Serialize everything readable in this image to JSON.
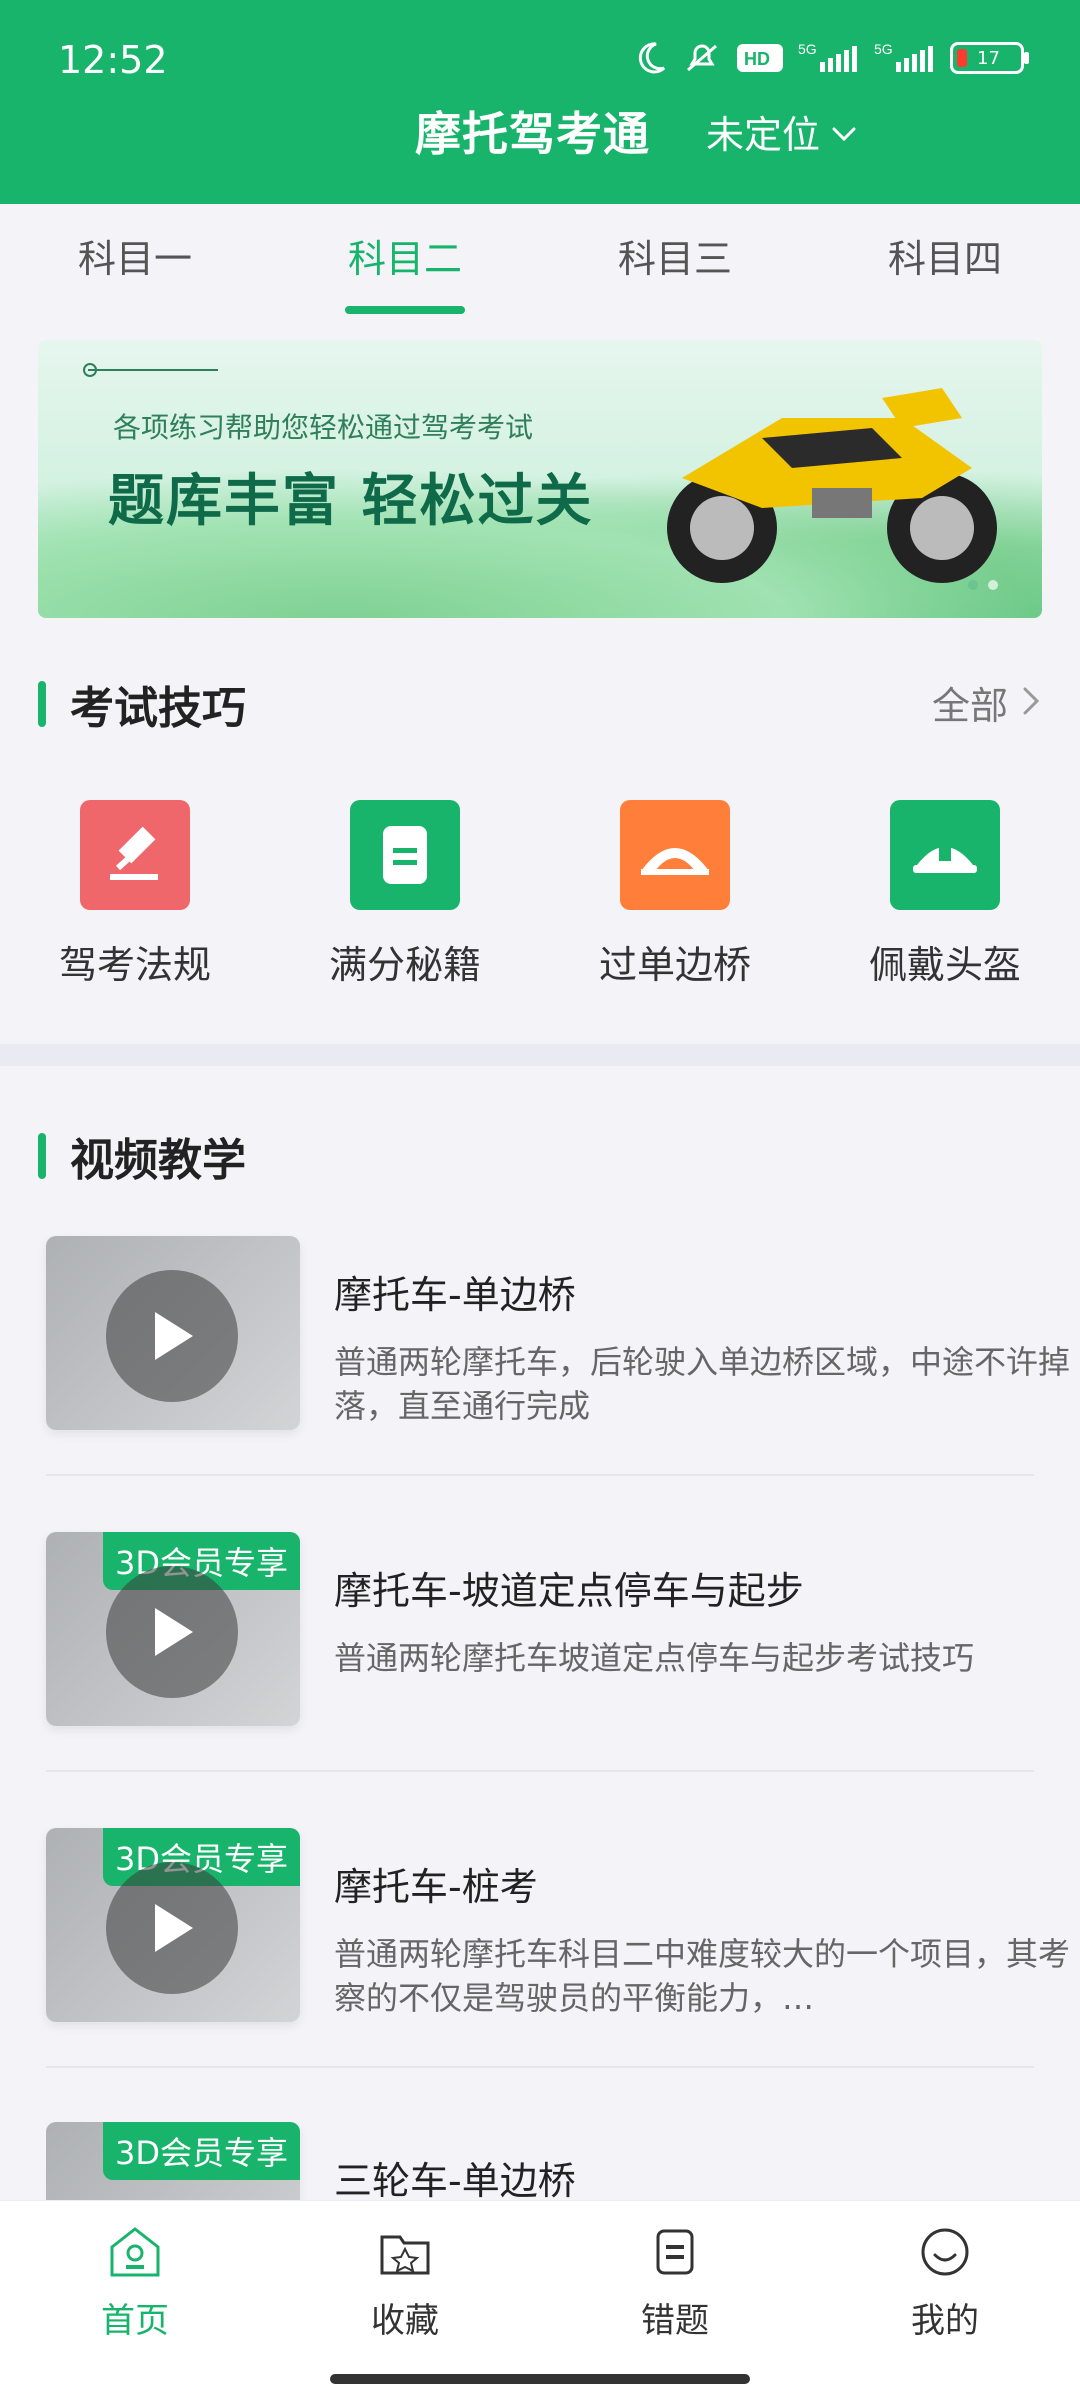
{
  "status_bar": {
    "time": "12:52",
    "battery": "17",
    "icons": [
      "moon-icon",
      "mute-icon",
      "hd-icon",
      "signal-5g-icon",
      "signal-5g-icon-2",
      "battery-icon"
    ]
  },
  "header": {
    "title": "摩托驾考通",
    "location": "未定位"
  },
  "tabs": [
    {
      "label": "科目一",
      "active": false
    },
    {
      "label": "科目二",
      "active": true
    },
    {
      "label": "科目三",
      "active": false
    },
    {
      "label": "科目四",
      "active": false
    }
  ],
  "banner": {
    "subtitle": "各项练习帮助您轻松通过驾考考试",
    "headline": "题库丰富 轻松过关"
  },
  "tips_section": {
    "title": "考试技巧",
    "see_all": "全部",
    "items": [
      {
        "label": "驾考法规",
        "icon": "gavel-icon",
        "color": "#f0676b"
      },
      {
        "label": "满分秘籍",
        "icon": "document-icon",
        "color": "#18b46b"
      },
      {
        "label": "过单边桥",
        "icon": "bridge-icon",
        "color": "#ff7f3a"
      },
      {
        "label": "佩戴头盔",
        "icon": "helmet-icon",
        "color": "#18b46b"
      }
    ]
  },
  "videos_section": {
    "title": "视频教学",
    "items": [
      {
        "title": "摩托车-单边桥",
        "desc": "普通两轮摩托车，后轮驶入单边桥区域，中途不许掉落，直至通行完成",
        "badge": ""
      },
      {
        "title": "摩托车-坡道定点停车与起步",
        "desc": "普通两轮摩托车坡道定点停车与起步考试技巧",
        "badge": "3D会员专享"
      },
      {
        "title": "摩托车-桩考",
        "desc": "普通两轮摩托车科目二中难度较大的一个项目，其考察的不仅是驾驶员的平衡能力，…",
        "badge": "3D会员专享"
      },
      {
        "title": "三轮车-单边桥",
        "desc": "",
        "badge": "3D会员专享"
      }
    ]
  },
  "bottom_nav": [
    {
      "label": "首页",
      "icon": "home-icon",
      "active": true
    },
    {
      "label": "收藏",
      "icon": "favorites-folder-icon",
      "active": false
    },
    {
      "label": "错题",
      "icon": "wrong-questions-icon",
      "active": false
    },
    {
      "label": "我的",
      "icon": "profile-smile-icon",
      "active": false
    }
  ]
}
